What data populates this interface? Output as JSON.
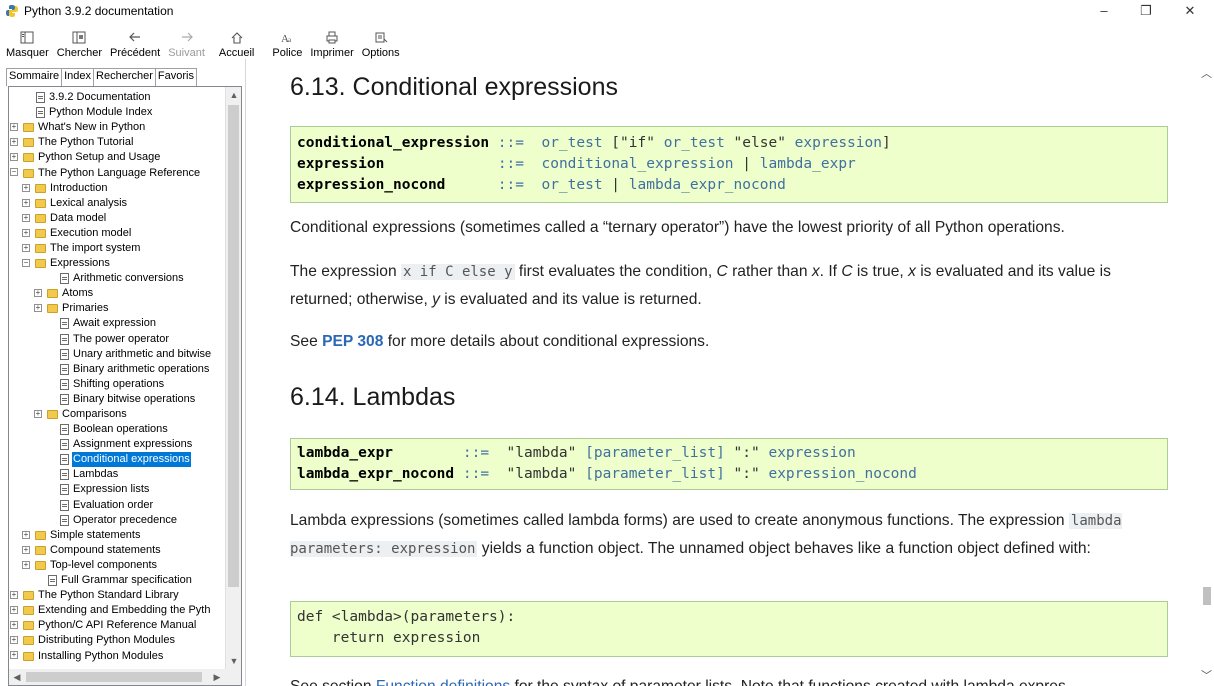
{
  "window": {
    "title": "Python 3.9.2 documentation",
    "controls": [
      "–",
      "❐",
      "✕"
    ]
  },
  "toolbar": {
    "buttons": [
      {
        "label": "Masquer",
        "icon": "hide-icon",
        "enabled": true
      },
      {
        "label": "Chercher",
        "icon": "locate-icon",
        "enabled": true
      },
      {
        "label": "Précédent",
        "icon": "back-arrow-icon",
        "enabled": true
      },
      {
        "label": "Suivant",
        "icon": "forward-arrow-icon",
        "enabled": false
      },
      {
        "label": "Accueil",
        "icon": "home-icon",
        "enabled": true
      },
      {
        "label": "Police",
        "icon": "font-icon",
        "enabled": true
      },
      {
        "label": "Imprimer",
        "icon": "print-icon",
        "enabled": true
      },
      {
        "label": "Options",
        "icon": "options-icon",
        "enabled": true
      }
    ]
  },
  "nav": {
    "tabs": [
      {
        "label": "Sommaire",
        "active": true
      },
      {
        "label": "Index",
        "active": false
      },
      {
        "label": "Rechercher",
        "active": false
      },
      {
        "label": "Favoris",
        "active": false
      }
    ],
    "tree": [
      {
        "label": "3.9.2 Documentation",
        "type": "page",
        "indent": 0,
        "expander": ""
      },
      {
        "label": "Python Module Index",
        "type": "page",
        "indent": 0,
        "expander": ""
      },
      {
        "label": "What's New in Python",
        "type": "folder",
        "indent": 0,
        "expander": "+"
      },
      {
        "label": "The Python Tutorial",
        "type": "folder",
        "indent": 0,
        "expander": "+"
      },
      {
        "label": "Python Setup and Usage",
        "type": "folder",
        "indent": 0,
        "expander": "+"
      },
      {
        "label": "The Python Language Reference",
        "type": "folder",
        "indent": 0,
        "expander": "-"
      },
      {
        "label": "Introduction",
        "type": "folder",
        "indent": 1,
        "expander": "+"
      },
      {
        "label": "Lexical analysis",
        "type": "folder",
        "indent": 1,
        "expander": "+"
      },
      {
        "label": "Data model",
        "type": "folder",
        "indent": 1,
        "expander": "+"
      },
      {
        "label": "Execution model",
        "type": "folder",
        "indent": 1,
        "expander": "+"
      },
      {
        "label": "The import system",
        "type": "folder",
        "indent": 1,
        "expander": "+"
      },
      {
        "label": "Expressions",
        "type": "folder",
        "indent": 1,
        "expander": "-"
      },
      {
        "label": "Arithmetic conversions",
        "type": "page",
        "indent": 2,
        "expander": ""
      },
      {
        "label": "Atoms",
        "type": "folder",
        "indent": 2,
        "expander": "+"
      },
      {
        "label": "Primaries",
        "type": "folder",
        "indent": 2,
        "expander": "+"
      },
      {
        "label": "Await expression",
        "type": "page",
        "indent": 2,
        "expander": ""
      },
      {
        "label": "The power operator",
        "type": "page",
        "indent": 2,
        "expander": ""
      },
      {
        "label": "Unary arithmetic and bitwise",
        "type": "page",
        "indent": 2,
        "expander": ""
      },
      {
        "label": "Binary arithmetic operations",
        "type": "page",
        "indent": 2,
        "expander": ""
      },
      {
        "label": "Shifting operations",
        "type": "page",
        "indent": 2,
        "expander": ""
      },
      {
        "label": "Binary bitwise operations",
        "type": "page",
        "indent": 2,
        "expander": ""
      },
      {
        "label": "Comparisons",
        "type": "folder",
        "indent": 2,
        "expander": "+"
      },
      {
        "label": "Boolean operations",
        "type": "page",
        "indent": 2,
        "expander": ""
      },
      {
        "label": "Assignment expressions",
        "type": "page",
        "indent": 2,
        "expander": ""
      },
      {
        "label": "Conditional expressions",
        "type": "page",
        "indent": 2,
        "expander": "",
        "selected": true
      },
      {
        "label": "Lambdas",
        "type": "page",
        "indent": 2,
        "expander": ""
      },
      {
        "label": "Expression lists",
        "type": "page",
        "indent": 2,
        "expander": ""
      },
      {
        "label": "Evaluation order",
        "type": "page",
        "indent": 2,
        "expander": ""
      },
      {
        "label": "Operator precedence",
        "type": "page",
        "indent": 2,
        "expander": ""
      },
      {
        "label": "Simple statements",
        "type": "folder",
        "indent": 1,
        "expander": "+"
      },
      {
        "label": "Compound statements",
        "type": "folder",
        "indent": 1,
        "expander": "+"
      },
      {
        "label": "Top-level components",
        "type": "folder",
        "indent": 1,
        "expander": "+"
      },
      {
        "label": "Full Grammar specification",
        "type": "page",
        "indent": 1,
        "expander": ""
      },
      {
        "label": "The Python Standard Library",
        "type": "folder",
        "indent": 0,
        "expander": "+"
      },
      {
        "label": "Extending and Embedding the Pyth",
        "type": "folder",
        "indent": 0,
        "expander": "+"
      },
      {
        "label": "Python/C API Reference Manual",
        "type": "folder",
        "indent": 0,
        "expander": "+"
      },
      {
        "label": "Distributing Python Modules",
        "type": "folder",
        "indent": 0,
        "expander": "+"
      },
      {
        "label": "Installing Python Modules",
        "type": "folder",
        "indent": 0,
        "expander": "+"
      }
    ]
  },
  "content": {
    "section1": {
      "heading": "6.13. Conditional expressions",
      "grammar": [
        {
          "name": "conditional_expression",
          "pad": " ",
          "op": "::=",
          "rhs": [
            {
              "t": "or_test",
              "c": "kw"
            },
            {
              "t": " [",
              "c": "str"
            },
            {
              "t": "\"if\"",
              "c": "str"
            },
            {
              "t": " ",
              "c": "str"
            },
            {
              "t": "or_test",
              "c": "kw"
            },
            {
              "t": " ",
              "c": "str"
            },
            {
              "t": "\"else\"",
              "c": "str"
            },
            {
              "t": " ",
              "c": "str"
            },
            {
              "t": "expression",
              "c": "kw"
            },
            {
              "t": "]",
              "c": "str"
            }
          ]
        },
        {
          "name": "expression",
          "pad": "             ",
          "op": "::=",
          "rhs": [
            {
              "t": "conditional_expression",
              "c": "kw"
            },
            {
              "t": " | ",
              "c": "str"
            },
            {
              "t": "lambda_expr",
              "c": "kw"
            }
          ]
        },
        {
          "name": "expression_nocond",
          "pad": "      ",
          "op": "::=",
          "rhs": [
            {
              "t": "or_test",
              "c": "kw"
            },
            {
              "t": " | ",
              "c": "str"
            },
            {
              "t": "lambda_expr_nocond",
              "c": "kw"
            }
          ]
        }
      ],
      "p1": "Conditional expressions (sometimes called a “ternary operator”) have the lowest priority of all Python operations.",
      "p2_pre": "The expression ",
      "p2_code": "x if C else y",
      "p2_a": " first evaluates the condition, ",
      "p2_c1": "C",
      "p2_b": " rather than ",
      "p2_x1": "x",
      "p2_c": ". If ",
      "p2_c2": "C",
      "p2_d": " is true, ",
      "p2_x2": "x",
      "p2_e": " is evaluated and its value is returned; otherwise, ",
      "p2_y": "y",
      "p2_f": " is evaluated and its value is returned.",
      "p3_pre": "See ",
      "p3_link": "PEP 308",
      "p3_post": " for more details about conditional expressions."
    },
    "section2": {
      "heading": "6.14. Lambdas",
      "grammar": [
        {
          "name": "lambda_expr",
          "pad": "        ",
          "op": "::=",
          "rhs": [
            {
              "t": "\"lambda\"",
              "c": "str"
            },
            {
              "t": " ",
              "c": "str"
            },
            {
              "t": "[parameter_list]",
              "c": "kw"
            },
            {
              "t": " \":\" ",
              "c": "str"
            },
            {
              "t": "expression",
              "c": "kw"
            }
          ]
        },
        {
          "name": "lambda_expr_nocond",
          "pad": " ",
          "op": "::=",
          "rhs": [
            {
              "t": "\"lambda\"",
              "c": "str"
            },
            {
              "t": " ",
              "c": "str"
            },
            {
              "t": "[parameter_list]",
              "c": "kw"
            },
            {
              "t": " \":\" ",
              "c": "str"
            },
            {
              "t": "expression_nocond",
              "c": "kw"
            }
          ]
        }
      ],
      "p1_pre": "Lambda expressions (sometimes called lambda forms) are used to create anonymous functions. The expression ",
      "p1_code": "lambda parameters: expression",
      "p1_post": " yields a function object. The unnamed object behaves like a function object defined with:",
      "code_lines": [
        "def <lambda>(parameters):",
        "    return expression"
      ],
      "p2_pre": "See section ",
      "p2_link": "Function definitions",
      "p2_post": " for the syntax of parameter lists. Note that functions created with lambda expres-"
    }
  },
  "colors": {
    "code_bg": "#eeffcc",
    "link": "#2a68b5",
    "selection": "#0078d7"
  }
}
